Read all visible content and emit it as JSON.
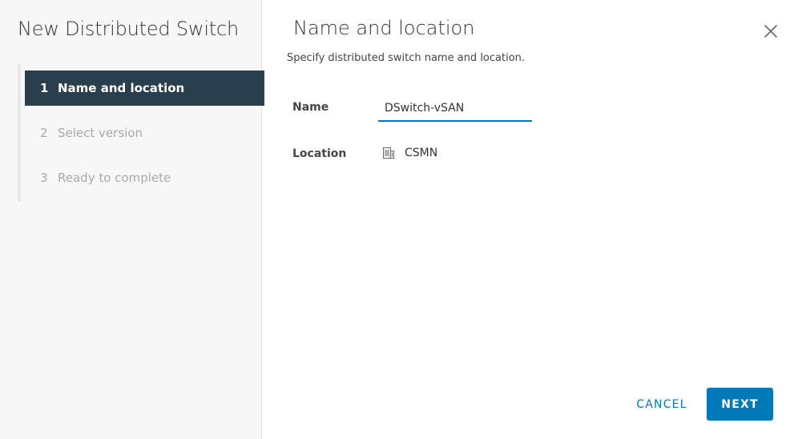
{
  "wizard": {
    "title": "New Distributed Switch",
    "steps": [
      {
        "number": "1",
        "label": "Name and location",
        "active": true
      },
      {
        "number": "2",
        "label": "Select version",
        "active": false
      },
      {
        "number": "3",
        "label": "Ready to complete",
        "active": false
      }
    ]
  },
  "page": {
    "title": "Name and location",
    "subtitle": "Specify distributed switch name and location.",
    "close_icon": "close-icon"
  },
  "form": {
    "name_label": "Name",
    "name_value": "DSwitch-vSAN",
    "location_label": "Location",
    "location_value": "CSMN",
    "location_icon": "datacenter-building-icon"
  },
  "footer": {
    "cancel_label": "CANCEL",
    "next_label": "NEXT"
  },
  "colors": {
    "active_step_bg": "#2a3f4e",
    "primary": "#0079b8",
    "sidebar_bg": "#f7f7f7"
  }
}
